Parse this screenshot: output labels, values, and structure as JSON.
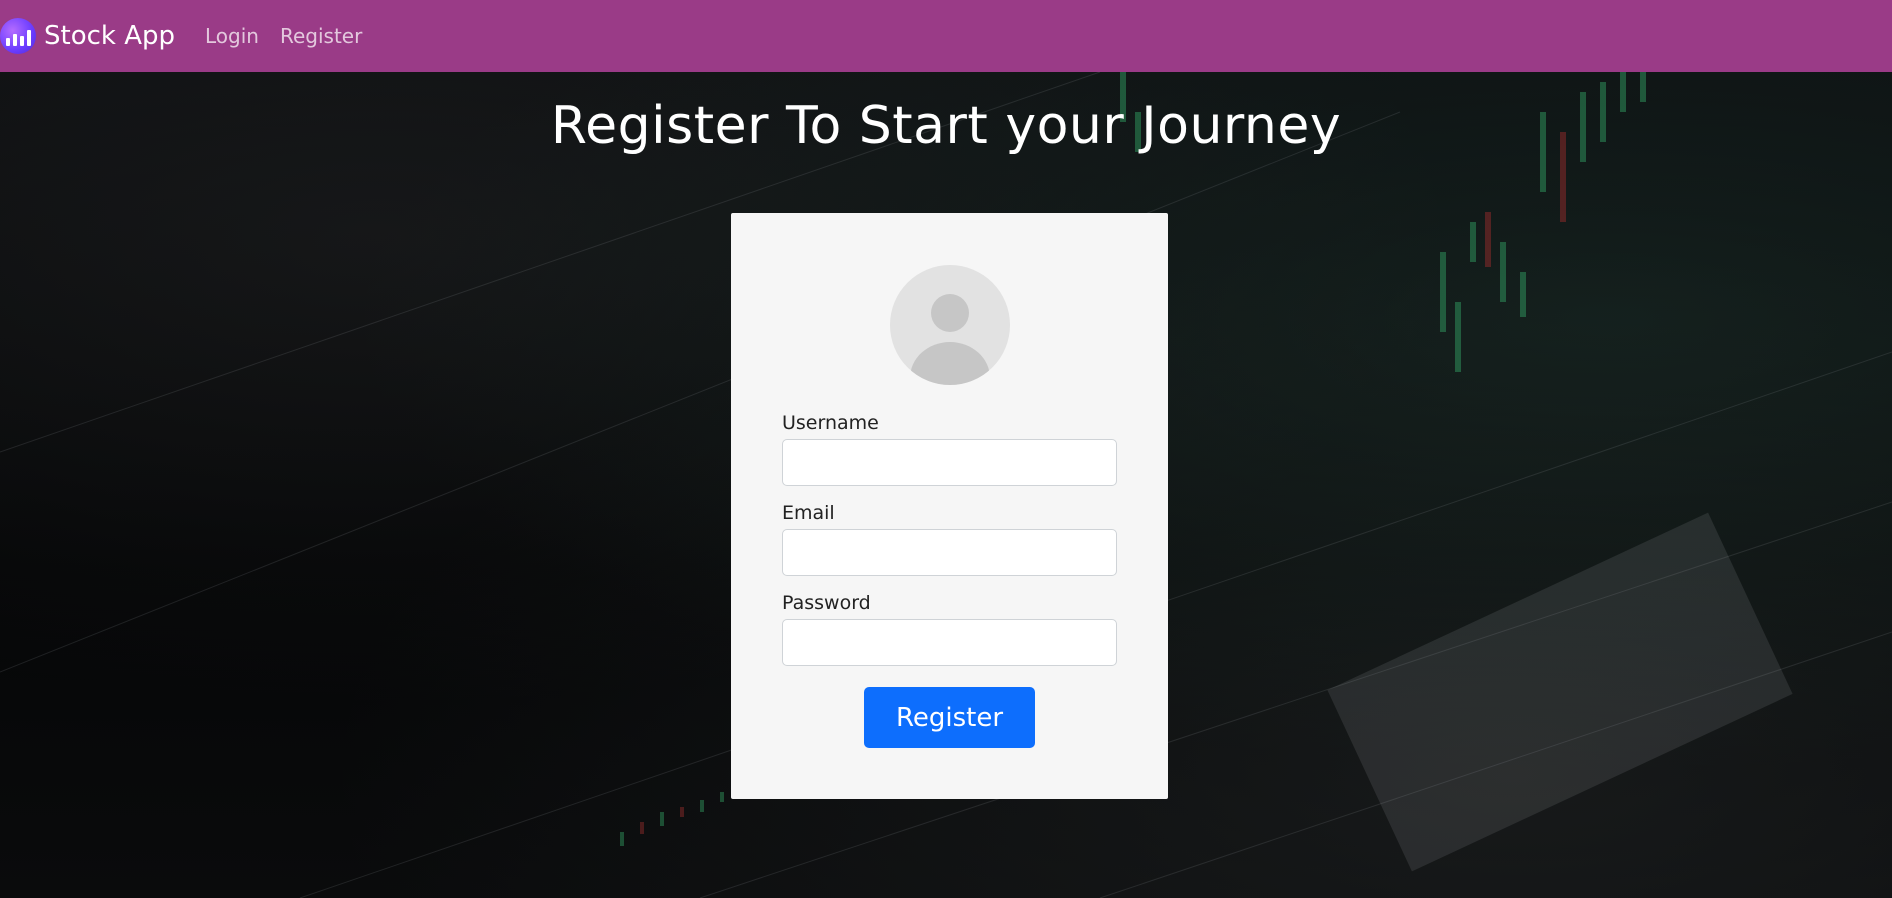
{
  "navbar": {
    "brand": "Stock App",
    "brand_icon": "bar-chart-logo-icon",
    "background_color": "#9a3b87",
    "links": [
      {
        "label": "Login"
      },
      {
        "label": "Register"
      }
    ]
  },
  "page": {
    "heading": "Register To Start your Journey"
  },
  "form": {
    "avatar_icon": "user-avatar-icon",
    "fields": [
      {
        "label": "Username",
        "value": "",
        "placeholder": ""
      },
      {
        "label": "Email",
        "value": "",
        "placeholder": ""
      },
      {
        "label": "Password",
        "value": "",
        "placeholder": ""
      }
    ],
    "submit_label": "Register",
    "submit_color": "#0d6efd"
  }
}
